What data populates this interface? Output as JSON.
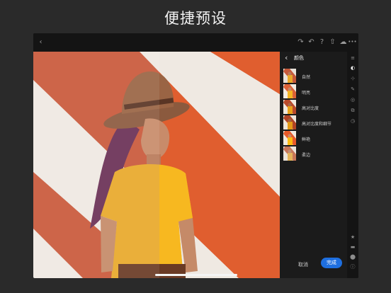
{
  "headline": "便捷预设",
  "topbar": {
    "back_icon": "‹",
    "redo_icon": "↷",
    "undo_icon": "↶",
    "help_icon": "?",
    "share_icon": "⇧",
    "cloud_icon": "☁",
    "more_icon": "•••"
  },
  "panel": {
    "back_icon": "‹",
    "title": "颜色",
    "presets": [
      {
        "label": "自然"
      },
      {
        "label": "明亮"
      },
      {
        "label": "高对比度"
      },
      {
        "label": "高对比度和细节"
      },
      {
        "label": "鲜艳"
      },
      {
        "label": "柔边"
      }
    ],
    "cancel_label": "取消",
    "done_label": "完成"
  },
  "rail_icons": [
    "≡",
    "◐",
    "⊹",
    "✎",
    "◎",
    "⧉",
    "◷",
    "★",
    "▬",
    "⬤",
    "ⓘ"
  ],
  "colors": {
    "accent": "#1e6fe0",
    "stripe_orange": "#c6593a",
    "shirt_yellow": "#f2b02a"
  }
}
